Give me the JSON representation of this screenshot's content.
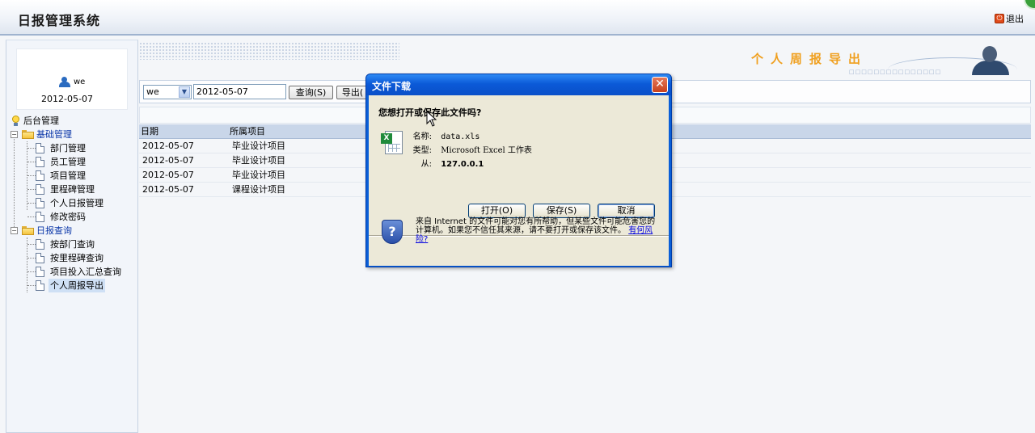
{
  "app": {
    "title": "日报管理系统",
    "logout_label": "退出"
  },
  "user": {
    "name": "we",
    "date": "2012-05-07"
  },
  "tree": {
    "root_label": "后台管理",
    "group1": {
      "label": "基础管理",
      "items": [
        "部门管理",
        "员工管理",
        "项目管理",
        "里程碑管理",
        "个人日报管理",
        "修改密码"
      ]
    },
    "group2": {
      "label": "日报查询",
      "items": [
        "按部门查询",
        "按里程碑查询",
        "项目投入汇总查询",
        "个人周报导出"
      ]
    }
  },
  "banner": {
    "title": "个人周报导出",
    "subtitle": "□□□□□□□□□□□□□□□"
  },
  "toolbar": {
    "user_select": "we",
    "date_value": "2012-05-07",
    "query_button": "查询(S)",
    "export_button": "导出("
  },
  "table": {
    "columns": [
      "日期",
      "所属项目"
    ],
    "rows": [
      [
        "2012-05-07",
        "毕业设计项目"
      ],
      [
        "2012-05-07",
        "毕业设计项目"
      ],
      [
        "2012-05-07",
        "毕业设计项目"
      ],
      [
        "2012-05-07",
        "课程设计项目"
      ]
    ]
  },
  "dialog": {
    "title": "文件下载",
    "question": "您想打开或保存此文件吗?",
    "name_label": "名称:",
    "name_value": "data.xls",
    "type_label": "类型:",
    "type_value": "Microsoft Excel 工作表",
    "from_label": "从:",
    "from_value": "127.0.0.1",
    "open_button": "打开(O)",
    "save_button": "保存(S)",
    "cancel_button": "取消",
    "warning_text": "来自 Internet 的文件可能对您有所帮助，但某些文件可能危害您的计算机。如果您不信任其来源，请不要打开或保存该文件。",
    "risk_link": "有何风险?",
    "close_glyph": "✕",
    "xls_badge": "X",
    "shield_glyph": "?"
  },
  "icons": {
    "logout": "power-icon",
    "user": "user-icon",
    "bulb": "bulb-icon",
    "folder": "folder-icon",
    "document": "document-icon"
  }
}
